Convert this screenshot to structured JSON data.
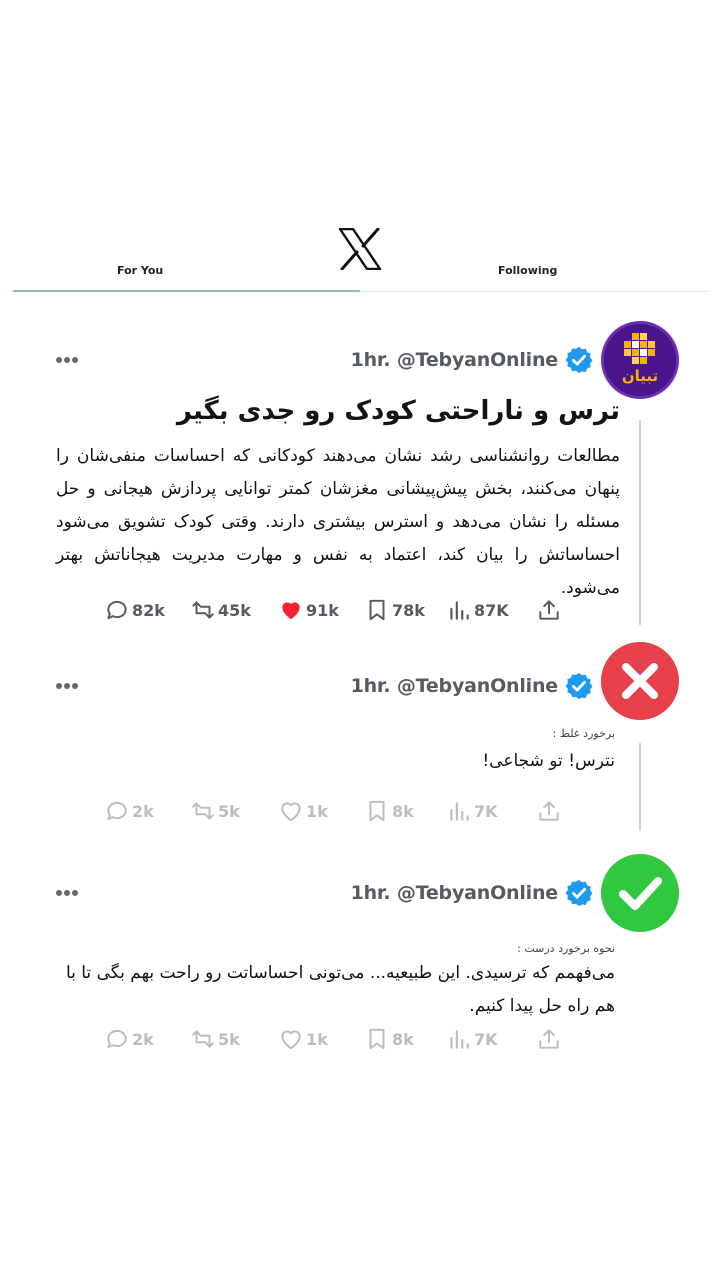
{
  "header": {
    "tabs": [
      {
        "label": "For You",
        "active": true
      },
      {
        "label": "Following",
        "active": false
      }
    ]
  },
  "tweets": [
    {
      "handle": "1hr. @TebyanOnline",
      "avatar_text": "تبیان",
      "title": "ترس و ناراحتی کودک رو جدی بگیر",
      "text": "مطالعات روانشناسی رشد نشان می‌دهند کودکانی که احساسات منفی‌شان را پنهان می‌کنند، بخش پیش‌پیشانی مغزشان کمتر توانایی پردازش هیجانی و حل مسئله را نشان می‌دهد و استرس بیشتری دارند. وقتی کودک تشویق می‌شود احساساتش را بیان کند، اعتماد به نفس و مهارت مدیریت هیجاناتش بهتر می‌شود.",
      "stats": {
        "replies": "82k",
        "retweets": "45k",
        "likes": "91k",
        "bookmarks": "78k",
        "views": "87K"
      }
    },
    {
      "handle": "1hr. @TebyanOnline",
      "caption": "برخورد غلط :",
      "text": "نترس! تو شجاعی!",
      "stats": {
        "replies": "2k",
        "retweets": "5k",
        "likes": "1k",
        "bookmarks": "8k",
        "views": "7K"
      }
    },
    {
      "handle": "1hr. @TebyanOnline",
      "caption": "نحوه برخورد درست :",
      "text": "می‌فهمم که ترسیدی. این طبیعیه... می‌تونی احساساتت رو راحت بهم بگی تا با هم راه حل پیدا کنیم.",
      "stats": {
        "replies": "2k",
        "retweets": "5k",
        "likes": "1k",
        "bookmarks": "8k",
        "views": "7K"
      }
    }
  ],
  "colors": {
    "verified": "#1d9bf0",
    "like": "#f4212e",
    "wrong": "#e8404a",
    "right": "#2fc83e",
    "brand_purple": "#4a148c",
    "brand_gold": "#f5b400"
  }
}
